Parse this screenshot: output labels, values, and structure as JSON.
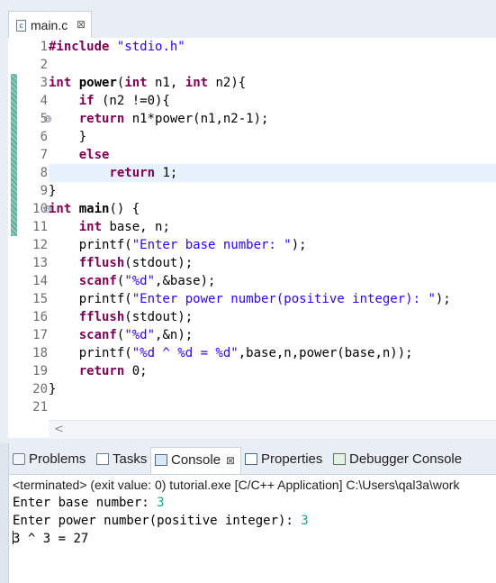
{
  "editor": {
    "tab_label": "main.c",
    "file_icon_letter": "c",
    "close_symbol": "⊠",
    "scroll_left_arrow": "<",
    "line_numbers": [
      "1",
      "2",
      "3",
      "4",
      "5",
      "6",
      "7",
      "8",
      "9",
      "10",
      "11",
      "12",
      "13",
      "14",
      "15",
      "16",
      "17",
      "18",
      "19",
      "20",
      "21"
    ],
    "fold_symbol": "⊖",
    "current_line": 8
  },
  "console": {
    "tabs": [
      {
        "label": "Problems",
        "icon": "problems-icon"
      },
      {
        "label": "Tasks",
        "icon": "tasks-icon"
      },
      {
        "label": "Console",
        "icon": "console-icon",
        "active": true
      },
      {
        "label": "Properties",
        "icon": "properties-icon"
      },
      {
        "label": "Debugger Console",
        "icon": "debugger-console-icon"
      }
    ],
    "close_symbol": "⊠",
    "status": "<terminated> (exit value: 0) tutorial.exe [C/C++ Application] C:\\Users\\qal3a\\work",
    "out1_prompt": "Enter base number: ",
    "out1_input": "3",
    "out2_prompt": "Enter power number(positive integer): ",
    "out2_input": "3",
    "out3_a": "3",
    "out3_b": " ^ 3 = 27"
  },
  "colors": {
    "keyword": "#7f0055",
    "string": "#2a00ff",
    "console_input": "#14a78b",
    "current_line_highlight": "#e8f2fe"
  }
}
